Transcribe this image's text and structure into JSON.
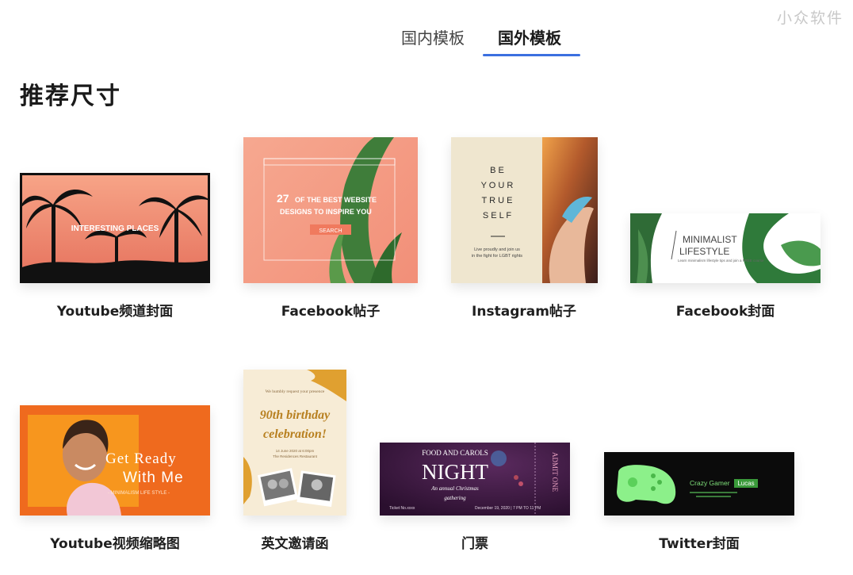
{
  "watermark": "小众软件",
  "tabs": [
    {
      "label": "国内模板",
      "active": false
    },
    {
      "label": "国外模板",
      "active": true
    }
  ],
  "accent_color": "#3b6fe0",
  "section_title": "推荐尺寸",
  "cards": [
    {
      "label": "Youtube频道封面",
      "thumb": {
        "text": "INTERESTING PLACES"
      }
    },
    {
      "label": "Facebook帖子",
      "thumb": {
        "line1_num": "27",
        "line1": "OF THE BEST WEBSITE",
        "line2": "DESIGNS TO INSPIRE YOU",
        "button": "SEARCH"
      }
    },
    {
      "label": "Instagram帖子",
      "thumb": {
        "words": [
          "B E",
          "Y O U R",
          "T R U E",
          "S E L F"
        ],
        "caption1": "Live proudly and join us",
        "caption2": "in the fight for LGBT rights"
      }
    },
    {
      "label": "Facebook封面",
      "thumb": {
        "title1": "MINIMALIST",
        "title2": "LIFESTYLE",
        "subtitle": "Learn minimalism lifestyle tips and join a FREE course"
      }
    },
    {
      "label": "Youtube视频缩略图",
      "thumb": {
        "line1": "Get Ready",
        "line2": "With Me",
        "caption": "- MINIMALISM LIFE STYLE -"
      }
    },
    {
      "label": "英文邀请函",
      "thumb": {
        "top": "We humbly request your presence",
        "title1": "90th birthday",
        "title2": "celebration!",
        "info1": "14 June 2020 at 6:00pm",
        "info2": "The Residences Restaurant"
      }
    },
    {
      "label": "门票",
      "thumb": {
        "top": "FOOD AND CAROLS",
        "title": "NIGHT",
        "sub1": "An annual Christmas",
        "sub2": "gathering",
        "ticket": "Ticket No.xxxx",
        "date": "December 19, 2020 | 7 PM TO 11 PM",
        "side": "ADMIT ONE"
      }
    },
    {
      "label": "Twitter封面",
      "thumb": {
        "text": "Crazy Gamer",
        "badge": "Lucas"
      }
    }
  ]
}
